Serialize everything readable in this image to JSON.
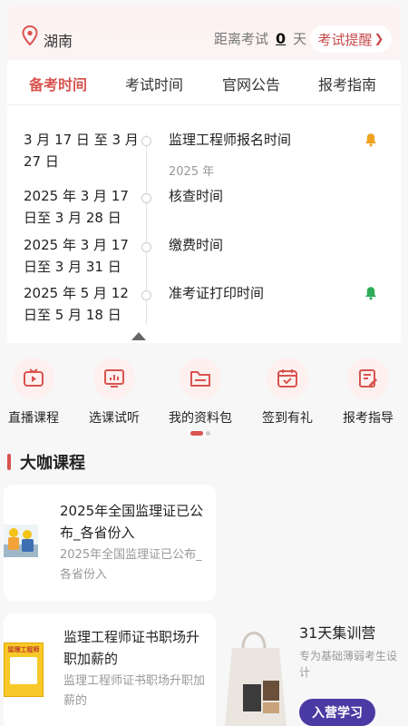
{
  "header": {
    "location": "湖南",
    "countdown_prefix": "距离考试",
    "countdown_days": "0",
    "countdown_unit": "天",
    "reminder_label": "考试提醒",
    "reminder_arrow": "❯"
  },
  "tabs": [
    "备考时间",
    "考试时间",
    "官网公告",
    "报考指南"
  ],
  "timeline": [
    {
      "date": "3 月 17 日 至 3 月 27 日",
      "title": "监理工程师报名时间",
      "sub": "2025 年",
      "bell_color": "#f0a020"
    },
    {
      "date": "2025 年 3 月 17 日至 3 月 28 日",
      "title": "核查时间"
    },
    {
      "date": "2025 年 3 月 17 日至 3 月 31 日",
      "title": "缴费时间"
    },
    {
      "date": "2025 年 5 月 12 日至 5 月 18 日",
      "title": "准考证打印时间",
      "bell_color": "#2eae5a"
    }
  ],
  "quick_nav": [
    {
      "label": "直播课程",
      "icon": "tv-icon"
    },
    {
      "label": "选课试听",
      "icon": "chart-screen-icon"
    },
    {
      "label": "我的资料包",
      "icon": "folder-icon"
    },
    {
      "label": "签到有礼",
      "icon": "calendar-check-icon"
    },
    {
      "label": "报考指导",
      "icon": "clipboard-pen-icon"
    }
  ],
  "section": {
    "title": "大咖课程"
  },
  "courses": [
    {
      "title": "2025年全国监理证已公布_各省份入",
      "sub": "2025年全国监理证已公布_各省份入"
    },
    {
      "title": "监理工程师证书职场升职加薪的",
      "sub": "监理工程师证书职场升职加薪的",
      "thumb_text": "监理工程师"
    }
  ],
  "promo": {
    "title": "31天集训营",
    "sub": "专为基础薄弱考生设计",
    "button": "入营学习"
  },
  "colors": {
    "accent": "#d9534f",
    "promo_button": "#4a3aa3"
  }
}
